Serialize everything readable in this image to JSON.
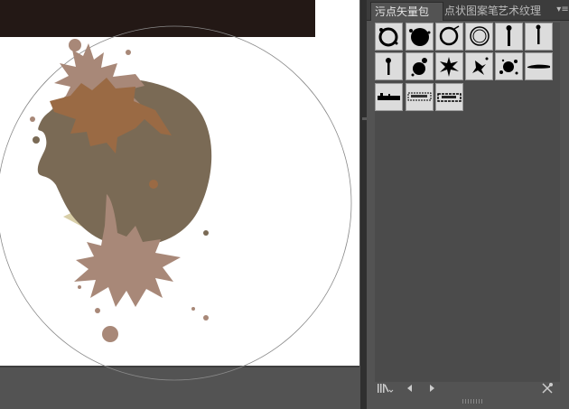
{
  "panel": {
    "tabs": [
      {
        "label": "污点矢量包",
        "active": true
      },
      {
        "label": "点状图案笔",
        "active": false
      },
      {
        "label": "艺术纹理",
        "active": false
      }
    ],
    "menu_icon": "panel-menu-icon"
  },
  "brushes": [
    {
      "name": "brush-ring-splatter-1"
    },
    {
      "name": "brush-blob-splatter"
    },
    {
      "name": "brush-ring-splatter-2"
    },
    {
      "name": "brush-ring-splatter-3"
    },
    {
      "name": "brush-drip-1"
    },
    {
      "name": "brush-drip-2"
    },
    {
      "name": "brush-drip-3"
    },
    {
      "name": "brush-splatter-1"
    },
    {
      "name": "brush-splatter-2"
    },
    {
      "name": "brush-splatter-3"
    },
    {
      "name": "brush-splatter-4"
    },
    {
      "name": "brush-stroke-1"
    },
    {
      "name": "brush-texture-1"
    },
    {
      "name": "brush-texture-2"
    },
    {
      "name": "brush-texture-3"
    }
  ],
  "bottom_icons": [
    "brush-libraries-menu-icon",
    "previous-library-icon",
    "next-library-icon",
    "remove-brush-stroke-icon"
  ],
  "colors": {
    "workspace": "#535353",
    "banner": "#231815",
    "splatter_dark": "#7a6a55",
    "splatter_orange": "#9a6a44",
    "splatter_pink": "#a88878"
  }
}
